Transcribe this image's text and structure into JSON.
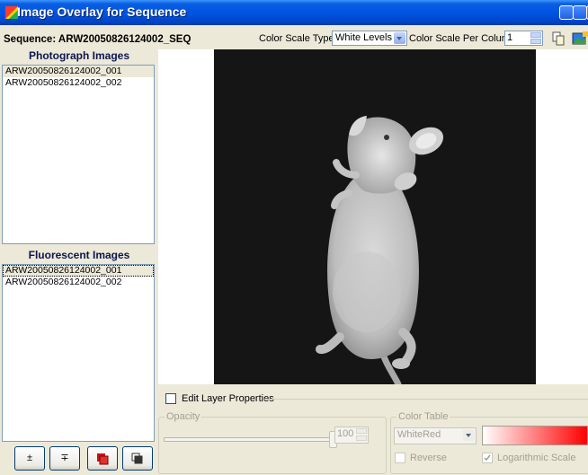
{
  "window": {
    "title": "Image Overlay for Sequence"
  },
  "toolbar": {
    "sequence_label": "Sequence: ARW20050826124002_SEQ",
    "color_scale_type_label": "Color Scale Type:",
    "color_scale_type_value": "White Levels",
    "color_scale_per_column_label": "Color Scale Per Column",
    "color_scale_per_column_value": "1",
    "copy_icon": "copy-icon",
    "export_icon": "export-image-icon"
  },
  "photograph_panel": {
    "title": "Photograph Images",
    "items": [
      "ARW20050826124002_001",
      "ARW20050826124002_002"
    ]
  },
  "fluorescent_panel": {
    "title": "Fluorescent Images",
    "items": [
      "ARW20050826124002_001",
      "ARW20050826124002_002"
    ]
  },
  "bottom_buttons": [
    {
      "label": "±",
      "icon": "plus-minus-icon"
    },
    {
      "label": "∓",
      "icon": "minus-plus-icon"
    },
    {
      "icon": "overlay-red-icon"
    },
    {
      "icon": "layers-icon"
    }
  ],
  "layer_properties": {
    "edit_label": "Edit Layer Properties",
    "edit_checked": false,
    "opacity_label": "Opacity",
    "opacity_value": "100",
    "color_table_label": "Color Table",
    "color_table_value": "WhiteRed",
    "reverse_label": "Reverse",
    "reverse_checked": false,
    "log_scale_label": "Logarithmic Scale",
    "log_scale_checked": true,
    "gradient_colors": [
      "#FFFFFF",
      "#FF0000"
    ]
  },
  "colors": {
    "titlebar": "#0054E3",
    "panel_title": "#0B1650",
    "background": "#ECE9D8",
    "image_background": "#141414"
  }
}
